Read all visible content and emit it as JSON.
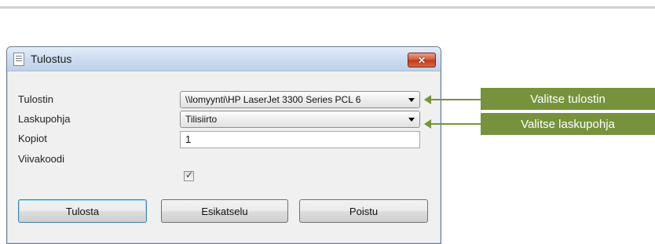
{
  "dialog": {
    "title": "Tulostus",
    "close_symbol": "✕",
    "fields": {
      "printer": {
        "label": "Tulostin",
        "value": "\\\\lomyynti\\HP LaserJet 3300 Series PCL 6"
      },
      "template": {
        "label": "Laskupohja",
        "value": "Tilisiirto"
      },
      "copies": {
        "label": "Kopiot",
        "value": "1"
      },
      "barcode": {
        "label": "Viivakoodi",
        "checked": true,
        "check_symbol": "✓"
      }
    },
    "buttons": {
      "print": "Tulosta",
      "preview": "Esikatselu",
      "exit": "Poistu"
    }
  },
  "callouts": {
    "printer": "Valitse tulostin",
    "template": "Valitse laskupohja"
  },
  "colors": {
    "callout_green": "#76923c",
    "close_red": "#c23a1c",
    "titlebar_blue": "#cddcef"
  },
  "icons": [
    "app-window-icon",
    "close-icon",
    "dropdown-arrow-icon",
    "checkmark-icon",
    "arrow-left-icon"
  ]
}
